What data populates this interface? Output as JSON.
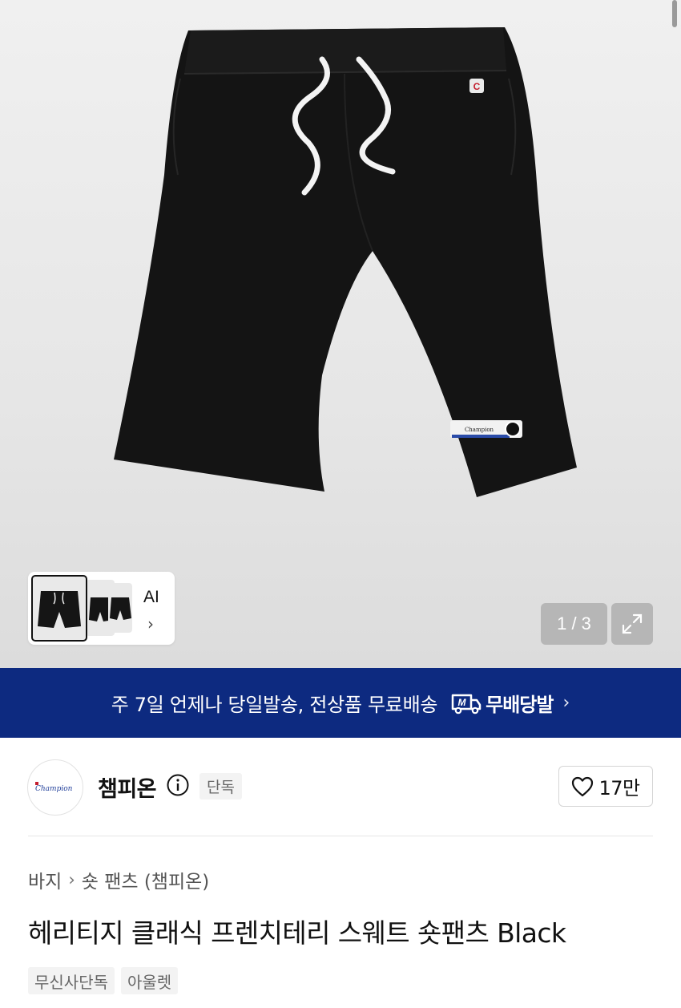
{
  "gallery": {
    "current_page": "1 / 3",
    "ai_label": "AI",
    "ai_chevron": "›",
    "main_image": "black-sweat-shorts",
    "thumbnail_count": 3
  },
  "banner": {
    "text": "주 7일 언제나 당일발송, 전상품 무료배송",
    "badge_text": "무배당발",
    "badge_icon": "delivery-truck-m-icon",
    "chevron": "›",
    "background_color": "#0d2a80"
  },
  "brand": {
    "name": "챔피온",
    "exclusive_tag": "단독",
    "like_count": "17만",
    "logo_text": "Champion"
  },
  "breadcrumb": {
    "items": [
      "바지",
      "숏 팬츠 (챔피온)"
    ],
    "separator": "›"
  },
  "product": {
    "title": "헤리티지 클래식 프렌치테리 스웨트 숏팬츠 Black",
    "tags": [
      "무신사단독",
      "아울렛"
    ]
  }
}
